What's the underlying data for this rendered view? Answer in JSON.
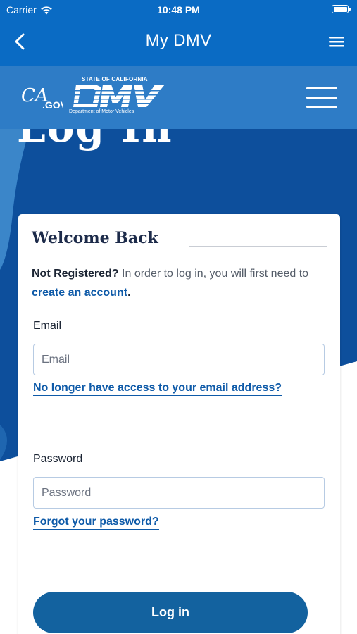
{
  "status_bar": {
    "carrier": "Carrier",
    "time": "10:48 PM"
  },
  "nav": {
    "title": "My DMV",
    "back_icon": "chevron-left-icon",
    "menu_icon": "hamburger-menu-icon"
  },
  "site_header": {
    "ca_logo": "CA.GOV",
    "dmv_state": "STATE OF CALIFORNIA",
    "dmv_name": "DMV",
    "dmv_dept": "Department of Motor Vehicles",
    "menu_icon": "hamburger-menu-icon"
  },
  "hero": {
    "heading": "Log In"
  },
  "card": {
    "title": "Welcome Back",
    "not_registered": "Not Registered?",
    "notice_text": " In order to log in, you will first need to ",
    "create_account": "create an account",
    "period": ".",
    "email_label": "Email",
    "email_placeholder": "Email",
    "email_value": "",
    "no_access_link": "No longer have access to your email address?",
    "password_label": "Password",
    "password_placeholder": "Password",
    "password_value": "",
    "forgot_link": "Forgot your password?"
  },
  "login_button": "Log in",
  "colors": {
    "nav_blue": "#0a6bc4",
    "header_blue": "#2e7cc6",
    "hero_blue": "#0d4f9c",
    "link_blue": "#0e5aa8",
    "button_blue": "#13629f",
    "title_navy": "#1d2b4a"
  }
}
